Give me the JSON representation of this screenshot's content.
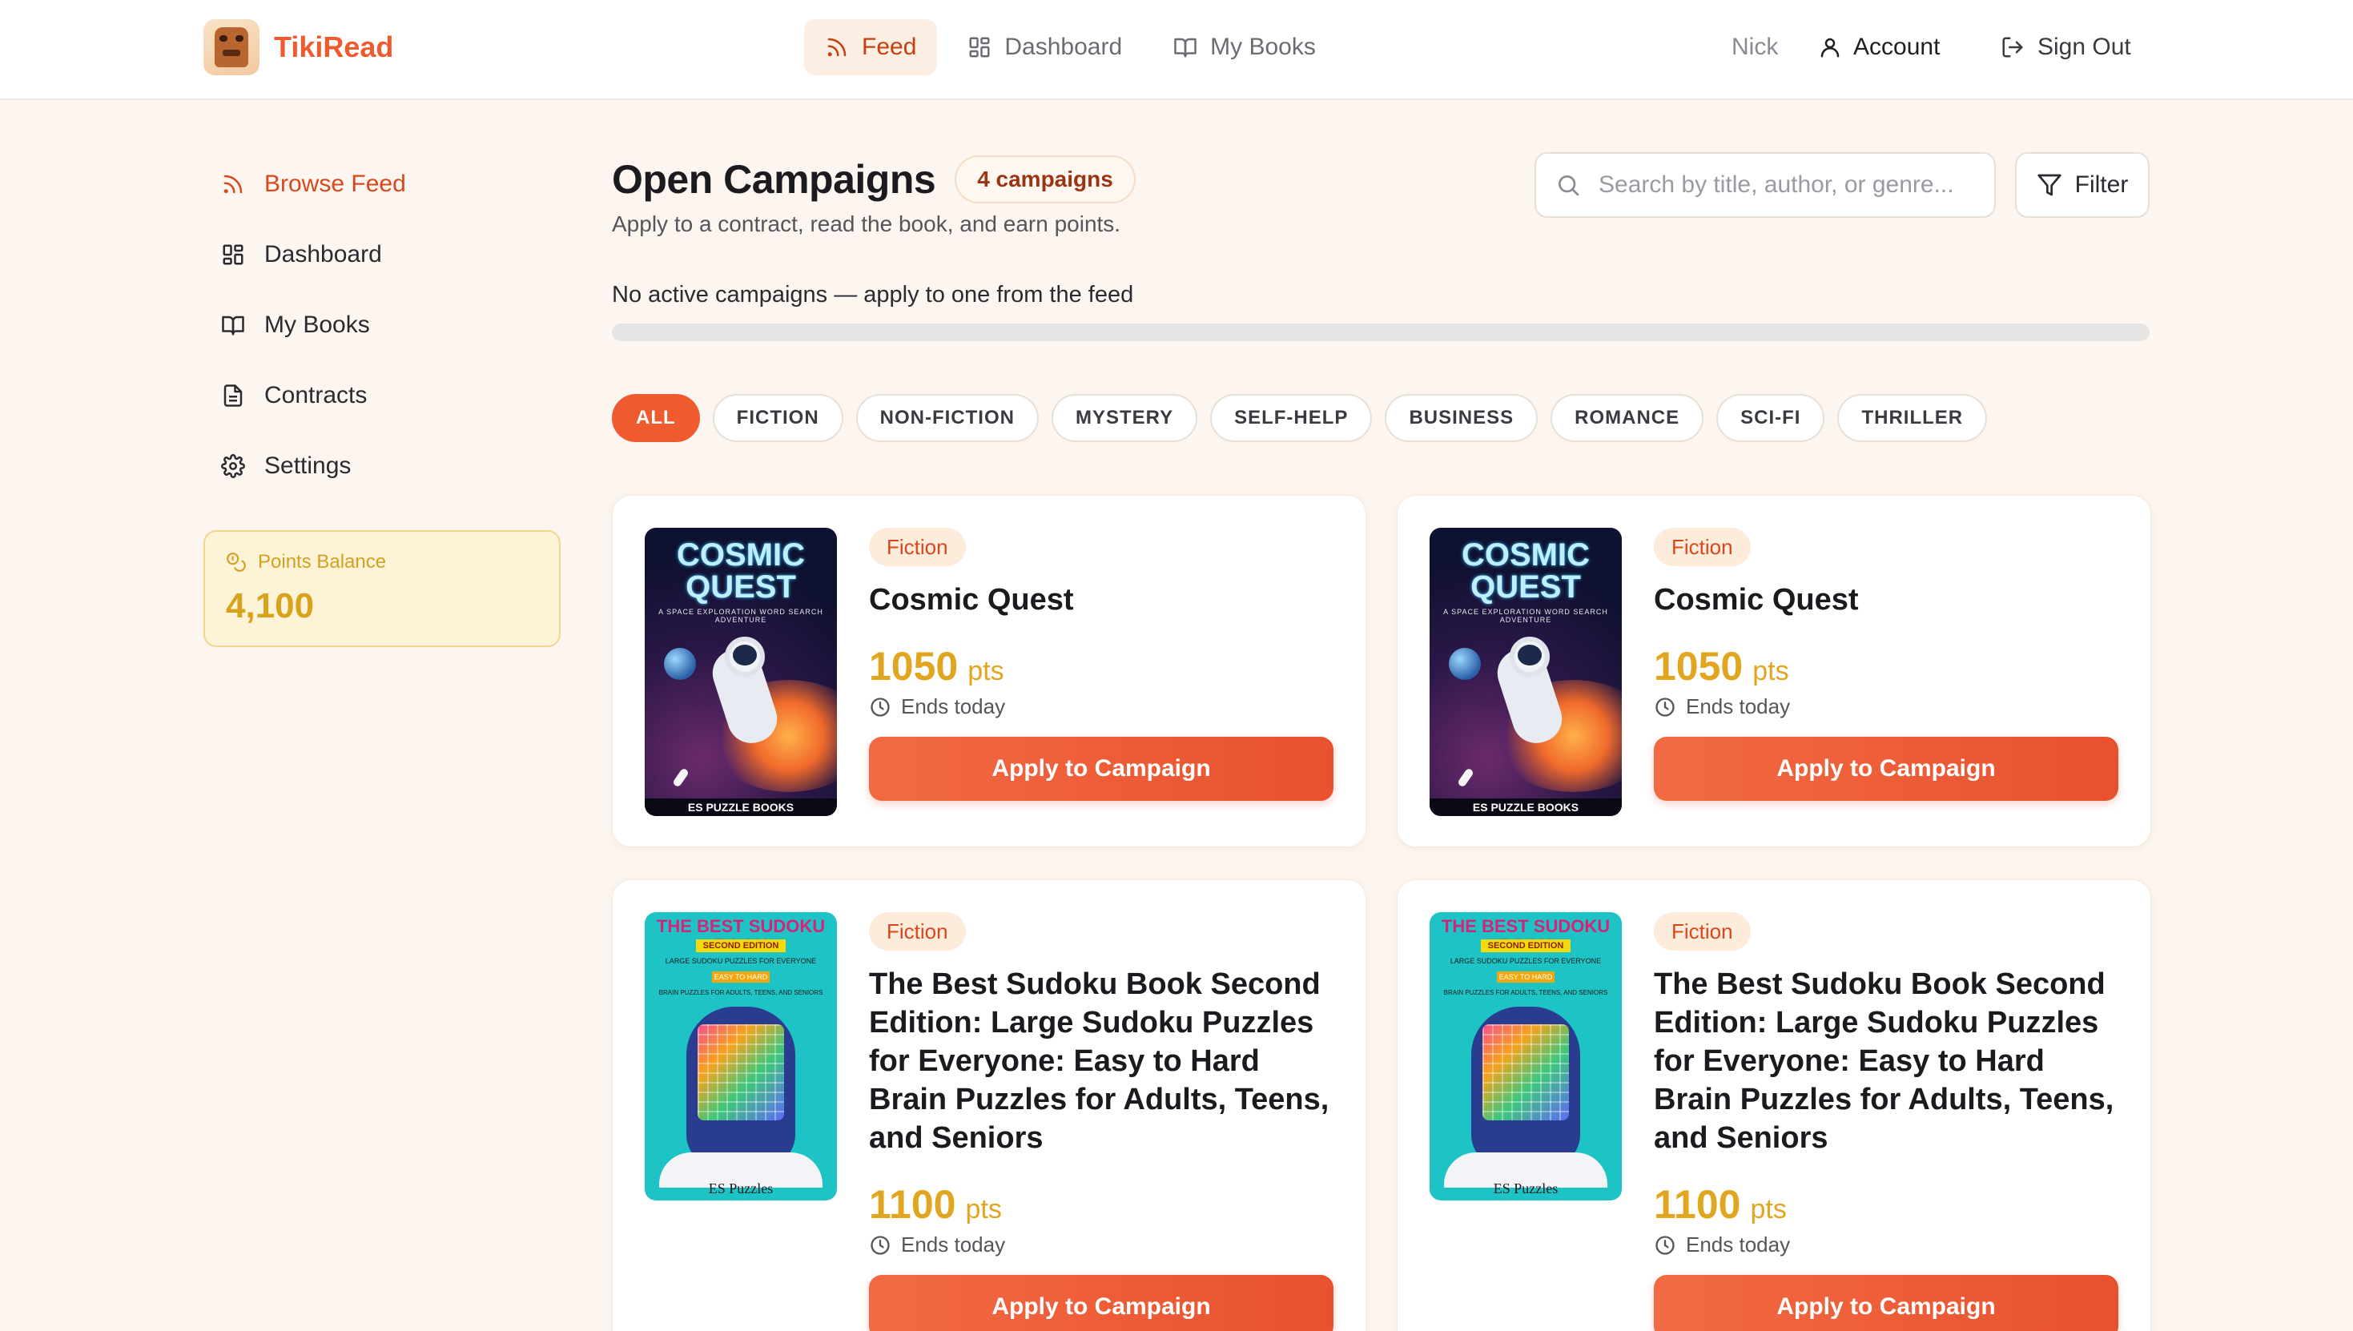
{
  "brand": {
    "name": "TikiRead"
  },
  "topnav": [
    {
      "label": "Feed",
      "icon": "rss-icon",
      "active": true
    },
    {
      "label": "Dashboard",
      "icon": "dashboard-icon",
      "active": false
    },
    {
      "label": "My Books",
      "icon": "book-open-icon",
      "active": false
    }
  ],
  "user": {
    "name": "Nick",
    "account_label": "Account",
    "signout_label": "Sign Out"
  },
  "sidebar": {
    "items": [
      {
        "label": "Browse Feed",
        "icon": "rss-icon",
        "active": true
      },
      {
        "label": "Dashboard",
        "icon": "dashboard-icon",
        "active": false
      },
      {
        "label": "My Books",
        "icon": "book-open-icon",
        "active": false
      },
      {
        "label": "Contracts",
        "icon": "document-icon",
        "active": false
      },
      {
        "label": "Settings",
        "icon": "gear-icon",
        "active": false
      }
    ],
    "points": {
      "label": "Points Balance",
      "value": "4,100",
      "icon": "coins-icon"
    }
  },
  "main": {
    "title": "Open Campaigns",
    "count_badge": "4 campaigns",
    "subtitle": "Apply to a contract, read the book, and earn points.",
    "search": {
      "placeholder": "Search by title, author, or genre...",
      "value": ""
    },
    "filter_label": "Filter",
    "active_message": "No active campaigns — apply to one from the feed",
    "progress_fraction": 0,
    "genres": [
      "ALL",
      "FICTION",
      "NON-FICTION",
      "MYSTERY",
      "SELF-HELP",
      "BUSINESS",
      "ROMANCE",
      "SCI-FI",
      "THRILLER"
    ],
    "active_genre": "ALL"
  },
  "campaigns": [
    {
      "genre": "Fiction",
      "title": "Cosmic Quest",
      "points": "1050",
      "points_unit": "pts",
      "ends": "Ends today",
      "cta": "Apply to Campaign",
      "cover": {
        "style": "cosmic",
        "title": "COSMIC QUEST",
        "subtitle": "A SPACE EXPLORATION WORD SEARCH ADVENTURE",
        "publisher": "ES PUZZLE BOOKS"
      }
    },
    {
      "genre": "Fiction",
      "title": "Cosmic Quest",
      "points": "1050",
      "points_unit": "pts",
      "ends": "Ends today",
      "cta": "Apply to Campaign",
      "cover": {
        "style": "cosmic",
        "title": "COSMIC QUEST",
        "subtitle": "A SPACE EXPLORATION WORD SEARCH ADVENTURE",
        "publisher": "ES PUZZLE BOOKS"
      }
    },
    {
      "genre": "Fiction",
      "title": "The Best Sudoku Book Second Edition: Large Sudoku Puzzles for Everyone: Easy to Hard Brain Puzzles for Adults, Teens, and Seniors",
      "points": "1100",
      "points_unit": "pts",
      "ends": "Ends today",
      "cta": "Apply to Campaign",
      "cover": {
        "style": "sudoku",
        "title": "THE BEST SUDOKU BOOK",
        "edition": "SECOND EDITION",
        "line1": "LARGE SUDOKU PUZZLES FOR EVERYONE",
        "line2": "EASY TO HARD",
        "line3": "BRAIN PUZZLES FOR ADULTS, TEENS, AND SENIORS",
        "publisher": "ES Puzzles"
      }
    },
    {
      "genre": "Fiction",
      "title": "The Best Sudoku Book Second Edition: Large Sudoku Puzzles for Everyone: Easy to Hard Brain Puzzles for Adults, Teens, and Seniors",
      "points": "1100",
      "points_unit": "pts",
      "ends": "Ends today",
      "cta": "Apply to Campaign",
      "cover": {
        "style": "sudoku",
        "title": "THE BEST SUDOKU BOOK",
        "edition": "SECOND EDITION",
        "line1": "LARGE SUDOKU PUZZLES FOR EVERYONE",
        "line2": "EASY TO HARD",
        "line3": "BRAIN PUZZLES FOR ADULTS, TEENS, AND SENIORS",
        "publisher": "ES Puzzles"
      }
    }
  ],
  "colors": {
    "accent": "#ef5b2f",
    "points": "#e2a51f",
    "background": "#fdf6f0"
  }
}
